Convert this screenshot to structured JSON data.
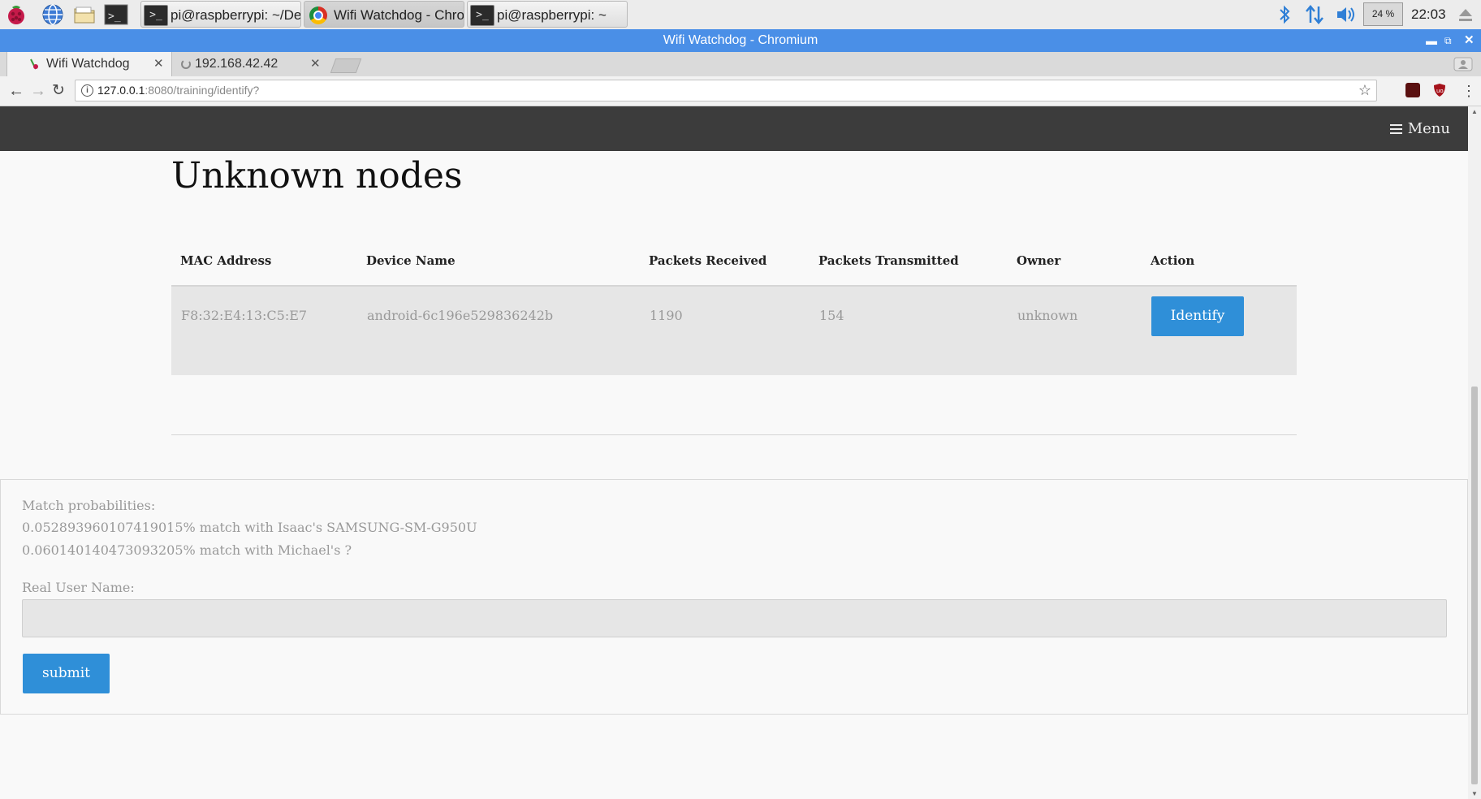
{
  "taskbar": {
    "windows": [
      {
        "label": "pi@raspberrypi: ~/De..."
      },
      {
        "label": "Wifi Watchdog - Chro..."
      },
      {
        "label": "pi@raspberrypi: ~"
      }
    ],
    "cpu": "24 %",
    "clock": "22:03"
  },
  "browser": {
    "window_title": "Wifi Watchdog - Chromium",
    "tabs": [
      {
        "label": "Wifi Watchdog"
      },
      {
        "label": "192.168.42.42"
      }
    ],
    "url_host": "127.0.0.1",
    "url_rest": ":8080/training/identify?"
  },
  "site": {
    "menu_label": "Menu",
    "heading": "Unknown nodes",
    "table": {
      "headers": [
        "MAC Address",
        "Device Name",
        "Packets Received",
        "Packets Transmitted",
        "Owner",
        "Action"
      ],
      "rows": [
        {
          "mac": "F8:32:E4:13:C5:E7",
          "device": "android-6c196e529836242b",
          "rx": "1190",
          "tx": "154",
          "owner": "unknown",
          "action": "Identify"
        }
      ]
    },
    "match": {
      "title": "Match probabilities:",
      "lines": [
        "0.0528939601074190​15% match with Isaac's SAMSUNG-SM-G950U",
        "0.060140140473093205% match with Michael's ?"
      ],
      "name_label": "Real User Name:",
      "name_value": "",
      "submit_label": "submit"
    }
  }
}
